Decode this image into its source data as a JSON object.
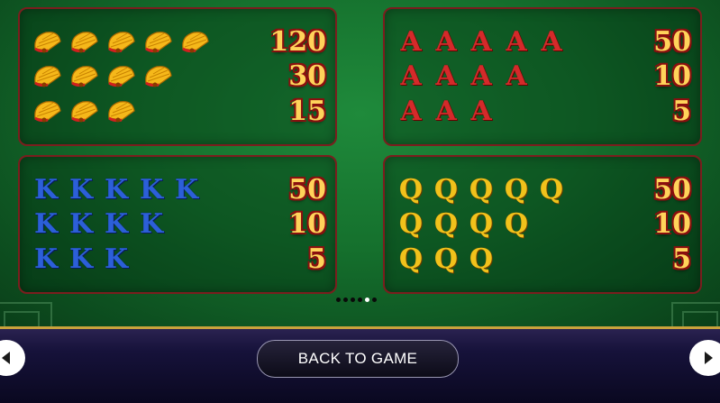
{
  "paytable": {
    "panels": [
      {
        "symbol": "fan",
        "rows": [
          {
            "count": 5,
            "payout": "120"
          },
          {
            "count": 4,
            "payout": "30"
          },
          {
            "count": 3,
            "payout": "15"
          }
        ]
      },
      {
        "symbol": "A",
        "rows": [
          {
            "count": 5,
            "payout": "50"
          },
          {
            "count": 4,
            "payout": "10"
          },
          {
            "count": 3,
            "payout": "5"
          }
        ]
      },
      {
        "symbol": "K",
        "rows": [
          {
            "count": 5,
            "payout": "50"
          },
          {
            "count": 4,
            "payout": "10"
          },
          {
            "count": 3,
            "payout": "5"
          }
        ]
      },
      {
        "symbol": "Q",
        "rows": [
          {
            "count": 5,
            "payout": "50"
          },
          {
            "count": 4,
            "payout": "10"
          },
          {
            "count": 3,
            "payout": "5"
          }
        ]
      }
    ],
    "pagination": {
      "total": 6,
      "current": 5
    }
  },
  "navigation": {
    "back_label": "BACK TO GAME",
    "prev_icon": "chevron-left-icon",
    "next_icon": "chevron-right-icon"
  },
  "colors": {
    "felt": "#15702d",
    "panel_border": "#7a1e1e",
    "payout_fill": "#ffd35a",
    "payout_outline": "#8a0f0f",
    "gold_trim": "#c9a23c"
  }
}
